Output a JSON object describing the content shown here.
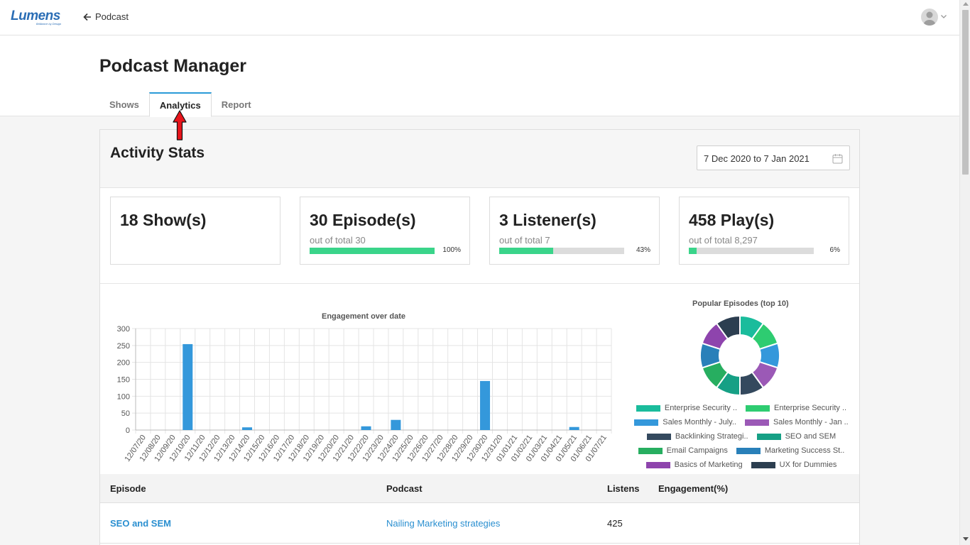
{
  "topbar": {
    "brand": "Lumens",
    "brand_tagline": "Brilliance by Design",
    "back_label": "Podcast"
  },
  "page": {
    "title": "Podcast Manager"
  },
  "tabs": [
    {
      "label": "Shows"
    },
    {
      "label": "Analytics",
      "active": true
    },
    {
      "label": "Report"
    }
  ],
  "activity": {
    "title": "Activity Stats",
    "date_range": "7 Dec 2020 to 7 Jan 2021"
  },
  "stats": [
    {
      "value": "18 Show(s)"
    },
    {
      "value": "30 Episode(s)",
      "sub": "out of total 30",
      "percent_label": "100%",
      "percent": 100
    },
    {
      "value": "3 Listener(s)",
      "sub": "out of total 7",
      "percent_label": "43%",
      "percent": 43
    },
    {
      "value": "458 Play(s)",
      "sub": "out of total 8,297",
      "percent_label": "6%",
      "percent": 6
    }
  ],
  "chart_data": [
    {
      "type": "bar",
      "title": "Engagement over date",
      "xlabel": "",
      "ylabel": "",
      "ylim": [
        0,
        300
      ],
      "yticks": [
        0,
        50,
        100,
        150,
        200,
        250,
        300
      ],
      "categories": [
        "12/07/20",
        "12/08/20",
        "12/09/20",
        "12/10/20",
        "12/11/20",
        "12/12/20",
        "12/13/20",
        "12/14/20",
        "12/15/20",
        "12/16/20",
        "12/17/20",
        "12/18/20",
        "12/19/20",
        "12/20/20",
        "12/21/20",
        "12/22/20",
        "12/23/20",
        "12/24/20",
        "12/25/20",
        "12/26/20",
        "12/27/20",
        "12/28/20",
        "12/29/20",
        "12/30/20",
        "12/31/20",
        "01/01/21",
        "01/02/21",
        "01/03/21",
        "01/04/21",
        "01/05/21",
        "01/06/21",
        "01/07/21"
      ],
      "values": [
        0,
        0,
        0,
        254,
        0,
        0,
        0,
        8,
        0,
        0,
        0,
        0,
        0,
        0,
        0,
        11,
        0,
        30,
        0,
        0,
        0,
        0,
        0,
        145,
        0,
        0,
        0,
        0,
        0,
        9,
        0,
        0
      ],
      "grid": true,
      "color": "#3498db"
    },
    {
      "type": "pie",
      "title": "Popular Episodes (top 10)",
      "donut": true,
      "labels": [
        "Enterprise Security ..",
        "Enterprise Security ..",
        "Sales Monthly - July..",
        "Sales Monthly - Jan ..",
        "Backlinking Strategi..",
        "SEO and SEM",
        "Email Campaigns",
        "Marketing Success St..",
        "Basics of Marketing",
        "UX for Dummies"
      ],
      "values": [
        1,
        1,
        1,
        1,
        1,
        1,
        1,
        1,
        1,
        1
      ],
      "colors": [
        "#1abc9c",
        "#2ecc71",
        "#3498db",
        "#9b59b6",
        "#34495e",
        "#16a085",
        "#27ae60",
        "#2980b9",
        "#8e44ad",
        "#2c3e50"
      ]
    }
  ],
  "table": {
    "headers": {
      "episode": "Episode",
      "podcast": "Podcast",
      "listens": "Listens",
      "engagement": "Engagement(%)"
    },
    "rows": [
      {
        "episode": "SEO and SEM",
        "podcast": "Nailing Marketing strategies",
        "listens": "425",
        "engagement": ""
      }
    ]
  }
}
